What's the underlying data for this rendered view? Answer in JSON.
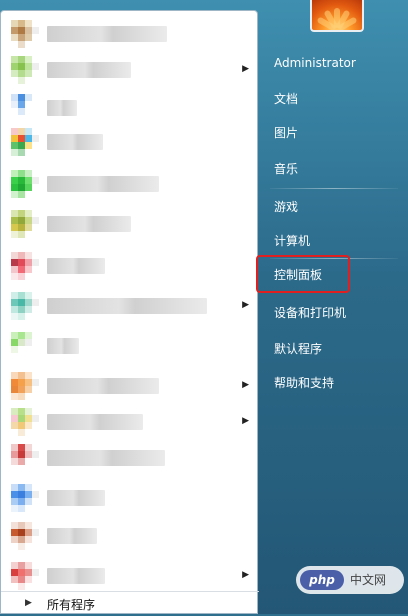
{
  "right_pane": {
    "items": [
      {
        "label": "Administrator"
      },
      {
        "label": "文档"
      },
      {
        "label": "图片"
      },
      {
        "label": "音乐"
      },
      {
        "label": "游戏"
      },
      {
        "label": "计算机"
      },
      {
        "label": "控制面板"
      },
      {
        "label": "设备和打印机"
      },
      {
        "label": "默认程序"
      },
      {
        "label": "帮助和支持"
      }
    ]
  },
  "left_pane": {
    "all_programs_label": "所有程序",
    "all_programs_arrow": "▶",
    "submenu_arrow": "▶"
  },
  "highlight": {
    "target": "控制面板",
    "color": "#e02020"
  },
  "watermark": {
    "badge": "php",
    "text": "中文网"
  }
}
